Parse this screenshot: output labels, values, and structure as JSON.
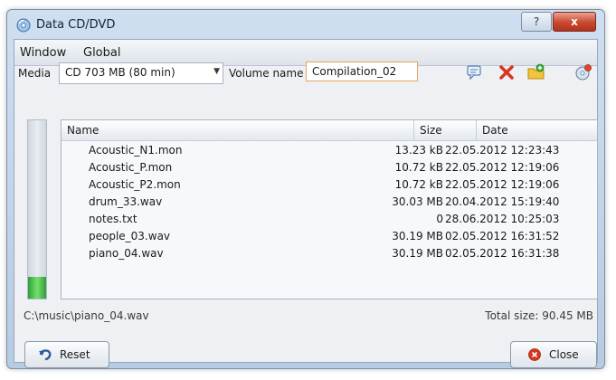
{
  "window": {
    "title": "Data CD/DVD",
    "title_icon": "disc-icon",
    "help_label": "?",
    "close_label": "x"
  },
  "menu": {
    "items": [
      "Window",
      "Global"
    ]
  },
  "toolbar": {
    "media_label": "Media",
    "media_value": "CD 703 MB (80 min)",
    "volume_label": "Volume name",
    "volume_value": "Compilation_02",
    "icons": [
      "info-icon",
      "delete-icon",
      "add-folder-icon",
      "burn-icon"
    ]
  },
  "meter": {
    "fill_fraction": 0.12,
    "color": "#4fcf52"
  },
  "file_list": {
    "headers": {
      "name": "Name",
      "size": "Size",
      "date": "Date"
    },
    "rows": [
      {
        "name": "Acoustic_N1.mon",
        "size": "13.23 kB",
        "date": "22.05.2012 12:23:43"
      },
      {
        "name": "Acoustic_P.mon",
        "size": "10.72 kB",
        "date": "22.05.2012 12:19:06"
      },
      {
        "name": "Acoustic_P2.mon",
        "size": "10.72 kB",
        "date": "22.05.2012 12:19:06"
      },
      {
        "name": "drum_33.wav",
        "size": "30.03 MB",
        "date": "20.04.2012 15:19:40"
      },
      {
        "name": "notes.txt",
        "size": "0",
        "date": "28.06.2012 10:25:03"
      },
      {
        "name": "people_03.wav",
        "size": "30.19 MB",
        "date": "02.05.2012 16:31:52"
      },
      {
        "name": "piano_04.wav",
        "size": "30.19 MB",
        "date": "02.05.2012 16:31:38"
      }
    ]
  },
  "status": {
    "path": "C:\\music\\piano_04.wav",
    "total": "Total size: 90.45 MB"
  },
  "buttons": {
    "reset_label": "Reset",
    "close_label": "Close"
  },
  "colors": {
    "accent": "#e6a65a",
    "close_red": "#c8482f",
    "meter_green": "#4fcf52"
  }
}
